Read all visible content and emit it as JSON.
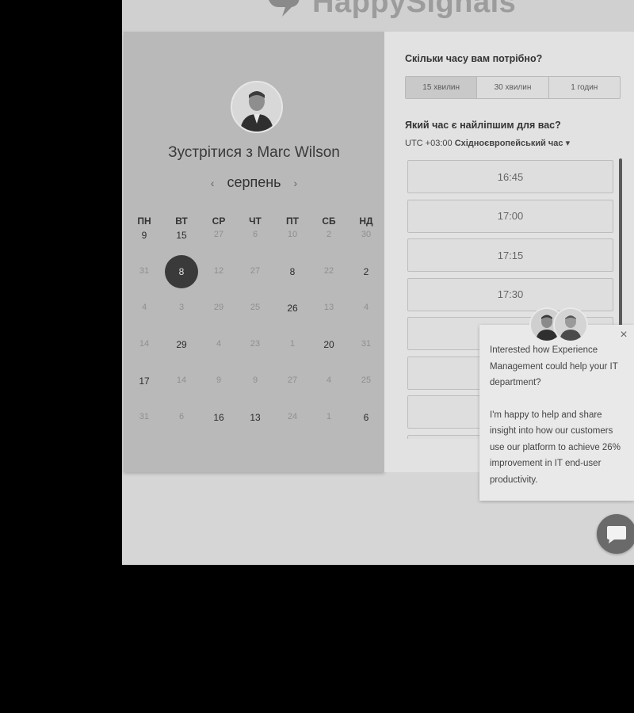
{
  "brand": {
    "logo_text": "HappySignals"
  },
  "meeting": {
    "title_prefix": "Зустрітися з",
    "host_name": "Marc Wilson",
    "month": "серпень",
    "prev_arrow": "‹",
    "next_arrow": "›"
  },
  "calendar": {
    "weekdays": [
      "ПН",
      "ВТ",
      "СР",
      "ЧТ",
      "ПТ",
      "СБ",
      "НД"
    ],
    "weeks": [
      [
        "9",
        "15",
        "27",
        "6",
        "10",
        "2",
        "30"
      ],
      [
        "31",
        "8",
        "12",
        "27",
        "8",
        "22",
        "2"
      ],
      [
        "4",
        "3",
        "29",
        "25",
        "26",
        "13",
        "4"
      ],
      [
        "14",
        "29",
        "4",
        "23",
        "1",
        "20",
        "31"
      ],
      [
        "17",
        "14",
        "9",
        "9",
        "27",
        "4",
        "25"
      ],
      [
        "31",
        "6",
        "16",
        "13",
        "24",
        "1",
        "6"
      ]
    ],
    "available": [
      [
        true,
        true,
        false,
        false,
        false,
        false,
        false
      ],
      [
        false,
        true,
        false,
        false,
        true,
        false,
        true
      ],
      [
        false,
        false,
        false,
        false,
        true,
        false,
        false
      ],
      [
        false,
        true,
        false,
        false,
        false,
        true,
        false
      ],
      [
        true,
        false,
        false,
        false,
        false,
        false,
        false
      ],
      [
        false,
        false,
        true,
        true,
        false,
        false,
        true
      ]
    ],
    "selected": {
      "week": 1,
      "day": 1
    }
  },
  "duration": {
    "question": "Скільки часу вам потрібно?",
    "options": [
      "15 хвилин",
      "30 хвилин",
      "1 годин"
    ],
    "selected_index": 0
  },
  "time": {
    "question": "Який час є найліпшим для вас?",
    "tz_offset": "UTC +03:00",
    "tz_name": "Східноєвропейський час",
    "tz_caret": "▾",
    "slots": [
      "16:45",
      "17:00",
      "17:15",
      "17:30",
      "",
      "",
      "",
      ""
    ]
  },
  "chat": {
    "line1": "Interested how Experience Management could help your IT department?",
    "line2": "I'm happy to help and share insight into how our customers use our platform to achieve 26% improvement in IT end-user productivity.",
    "close_glyph": "×"
  }
}
